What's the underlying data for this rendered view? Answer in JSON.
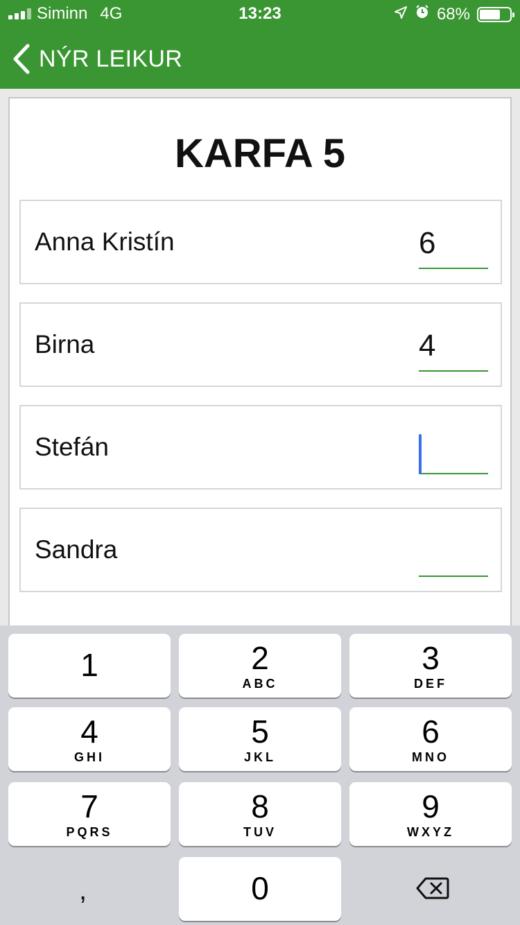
{
  "status_bar": {
    "carrier": "Siminn",
    "network": "4G",
    "time": "13:23",
    "battery": "68%",
    "battery_level": 0.68,
    "icons": [
      "signal-icon",
      "location-arrow-icon",
      "alarm-icon",
      "battery-icon"
    ]
  },
  "nav": {
    "back_label": "NÝR LEIKUR"
  },
  "card": {
    "title": "KARFA 5",
    "players": [
      {
        "name": "Anna Kristín",
        "score": "6"
      },
      {
        "name": "Birna",
        "score": "4"
      },
      {
        "name": "Stefán",
        "score": ""
      },
      {
        "name": "Sandra",
        "score": ""
      }
    ]
  },
  "keypad": {
    "keys": [
      {
        "num": "1",
        "letters": ""
      },
      {
        "num": "2",
        "letters": "ABC"
      },
      {
        "num": "3",
        "letters": "DEF"
      },
      {
        "num": "4",
        "letters": "GHI"
      },
      {
        "num": "5",
        "letters": "JKL"
      },
      {
        "num": "6",
        "letters": "MNO"
      },
      {
        "num": "7",
        "letters": "PQRS"
      },
      {
        "num": "8",
        "letters": "TUV"
      },
      {
        "num": "9",
        "letters": "WXYZ"
      },
      {
        "num": "0",
        "letters": ""
      }
    ],
    "comma": ",",
    "delete_icon": "backspace-icon"
  },
  "colors": {
    "accent": "#3a9632",
    "cursor": "#3a6df0",
    "keyboard_bg": "#d1d3d9"
  }
}
